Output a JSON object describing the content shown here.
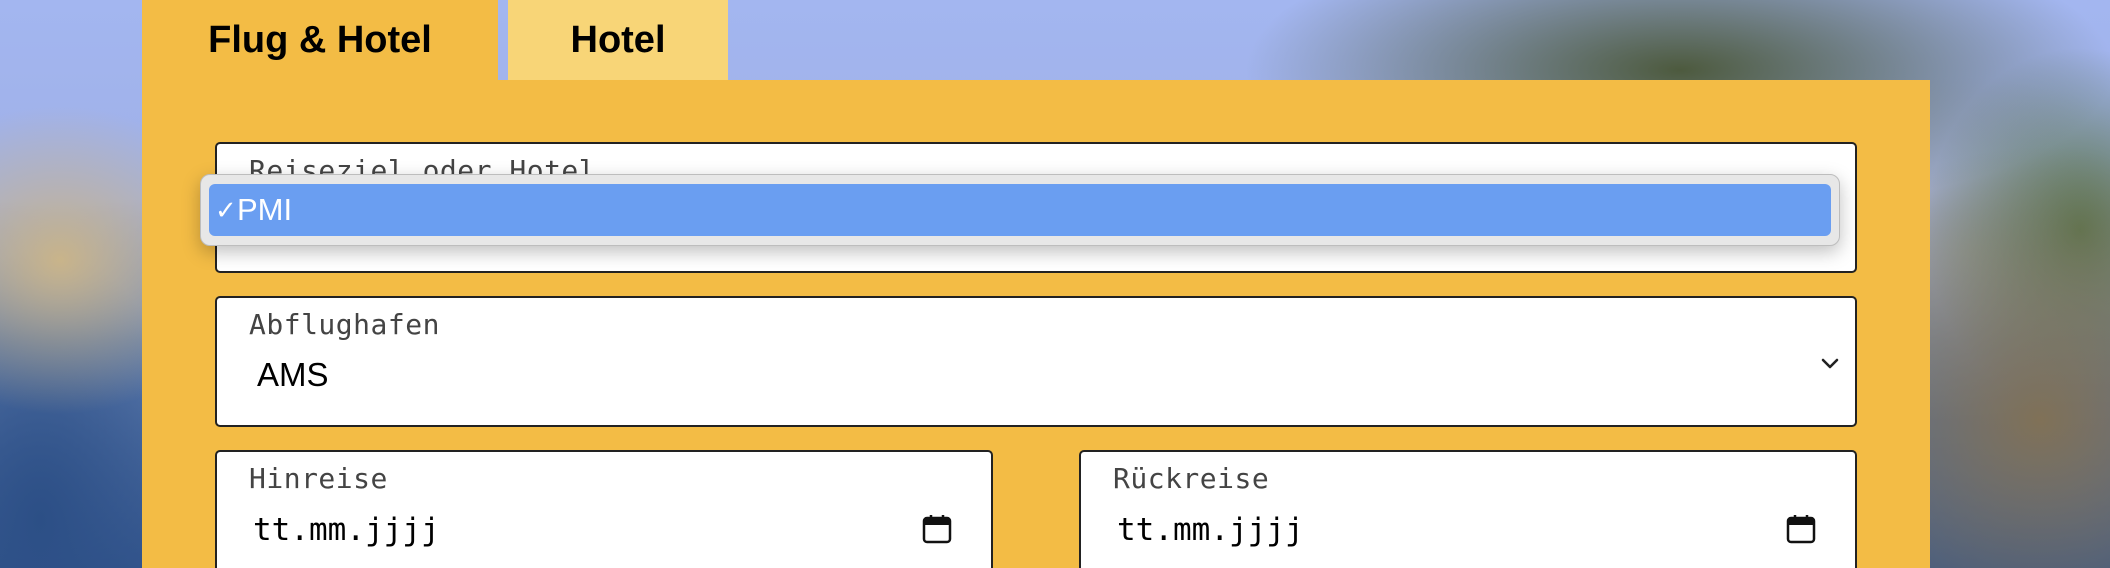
{
  "tabs": [
    {
      "label": "Flug & Hotel",
      "active": true
    },
    {
      "label": "Hotel",
      "active": false
    }
  ],
  "form": {
    "destination": {
      "label": "Reiseziel oder Hotel",
      "options": [
        {
          "label": "PMI",
          "selected": true
        }
      ]
    },
    "departure_airport": {
      "label": "Abflughafen",
      "value": "AMS"
    },
    "outbound": {
      "label": "Hinreise",
      "placeholder": "tt.mm.jjjj"
    },
    "return": {
      "label": "Rückreise",
      "placeholder": "tt.mm.jjjj"
    }
  },
  "icons": {
    "check": "checkmark-icon",
    "chevron": "chevron-down-icon",
    "calendar": "calendar-icon"
  },
  "colors": {
    "panel": "#f3bc45",
    "tab_inactive": "#f8d577",
    "option_highlight": "#6a9ef1"
  }
}
